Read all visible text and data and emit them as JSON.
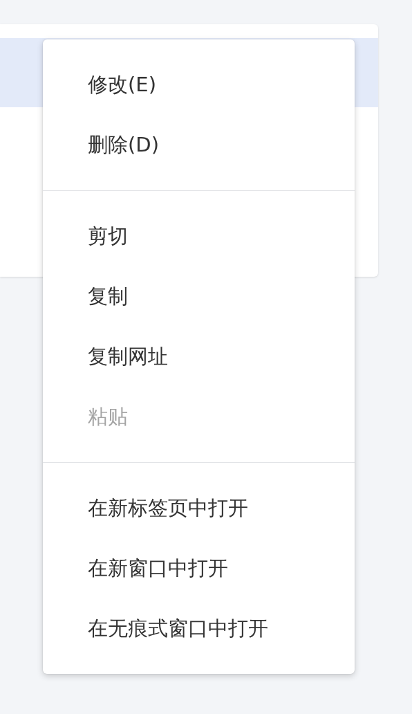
{
  "background_list": {
    "rows": [
      {
        "selected": true
      },
      {
        "selected": false
      }
    ]
  },
  "context_menu": {
    "groups": [
      {
        "items": [
          {
            "label": "修改(E)",
            "disabled": false
          },
          {
            "label": "删除(D)",
            "disabled": false
          }
        ]
      },
      {
        "items": [
          {
            "label": "剪切",
            "disabled": false
          },
          {
            "label": "复制",
            "disabled": false
          },
          {
            "label": "复制网址",
            "disabled": false
          },
          {
            "label": "粘贴",
            "disabled": true
          }
        ]
      },
      {
        "items": [
          {
            "label": "在新标签页中打开",
            "disabled": false
          },
          {
            "label": "在新窗口中打开",
            "disabled": false
          },
          {
            "label": "在无痕式窗口中打开",
            "disabled": false
          }
        ]
      }
    ]
  }
}
